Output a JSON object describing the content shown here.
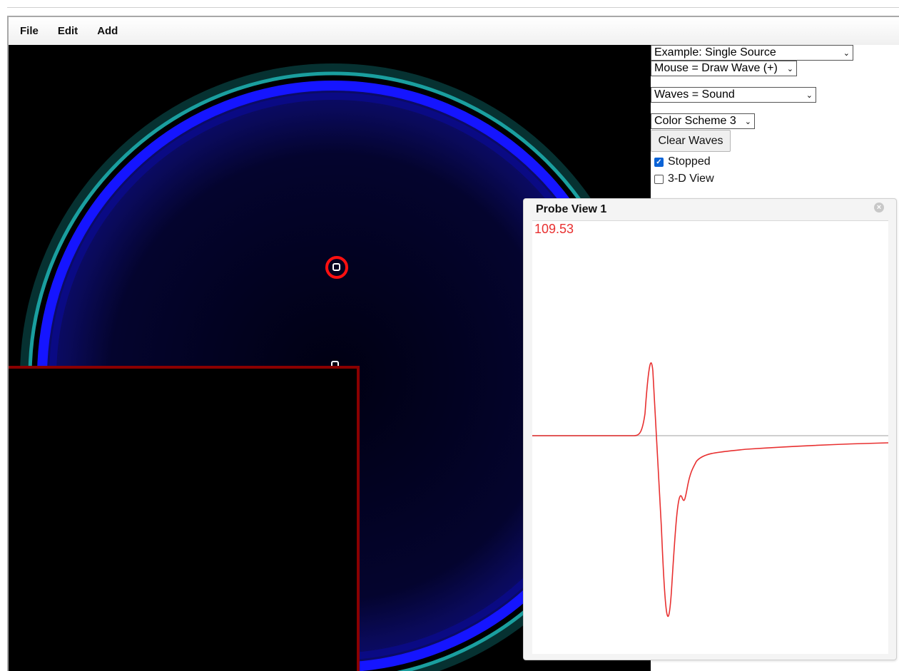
{
  "menu": {
    "file": "File",
    "edit": "Edit",
    "add": "Add"
  },
  "controls": {
    "example_select": "Example: Single Source",
    "mouse_select": "Mouse = Draw Wave (+)",
    "waves_select": "Waves = Sound",
    "color_select": "Color Scheme 3",
    "clear_button": "Clear Waves",
    "stopped_label": "Stopped",
    "stopped_checked": true,
    "view3d_label": "3-D View",
    "view3d_checked": false
  },
  "probe_window": {
    "title": "Probe View 1",
    "value": "109.53",
    "trace_color": "#e83030"
  },
  "icons": {
    "close": "close-icon",
    "dropdown": "chevron-down-icon",
    "check": "checkmark-icon"
  }
}
